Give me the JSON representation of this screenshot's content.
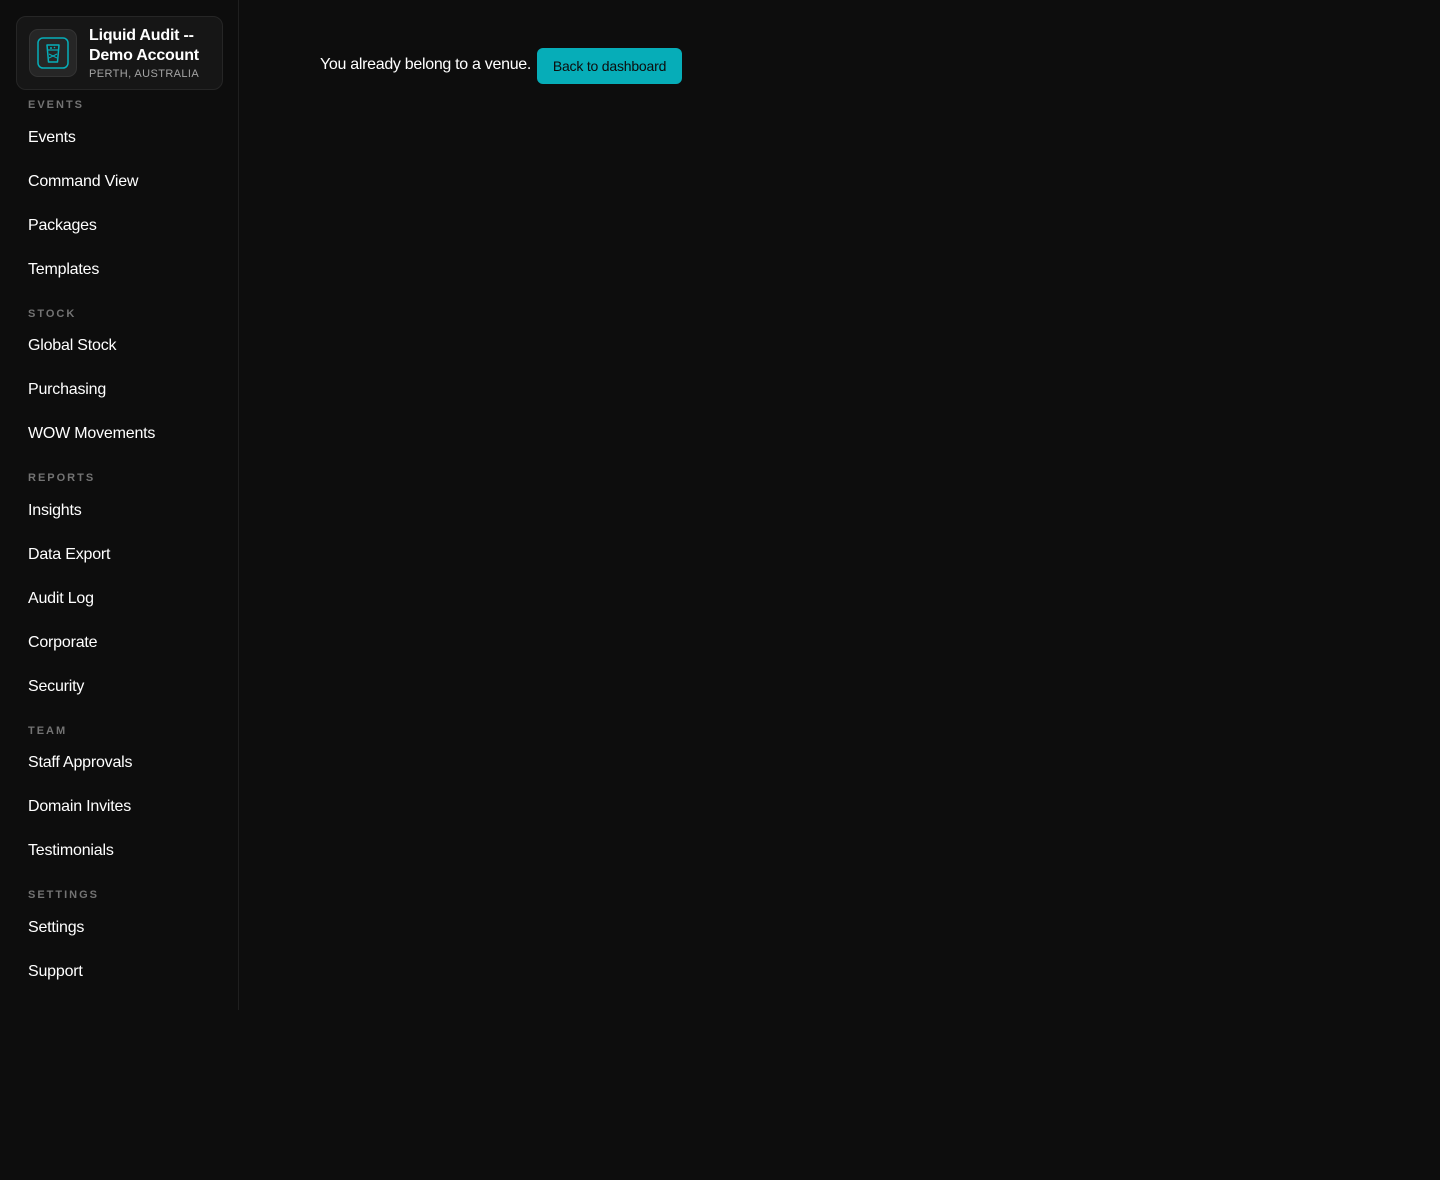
{
  "venue": {
    "name": "Liquid Audit -- Demo Account",
    "location": "PERTH, AUSTRALIA",
    "logo_icon": "glass-icon"
  },
  "sidebar": {
    "sections": [
      {
        "label": "EVENTS",
        "items": [
          "Events",
          "Command View",
          "Packages",
          "Templates"
        ]
      },
      {
        "label": "STOCK",
        "items": [
          "Global Stock",
          "Purchasing",
          "WOW Movements"
        ]
      },
      {
        "label": "REPORTS",
        "items": [
          "Insights",
          "Data Export",
          "Audit Log",
          "Corporate",
          "Security"
        ]
      },
      {
        "label": "TEAM",
        "items": [
          "Staff Approvals",
          "Domain Invites",
          "Testimonials"
        ]
      },
      {
        "label": "SETTINGS",
        "items": [
          "Settings",
          "Support"
        ]
      }
    ]
  },
  "main": {
    "message": "You already belong to a venue.",
    "back_button_label": "Back to dashboard"
  },
  "colors": {
    "background": "#0d0d0d",
    "accent": "#06adb8",
    "section_label": "#737373"
  }
}
